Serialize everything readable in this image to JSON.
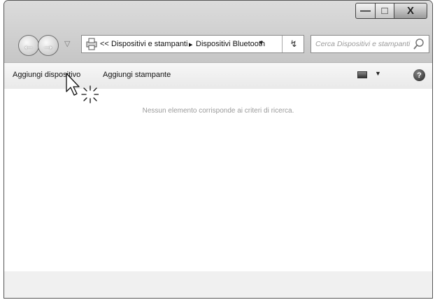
{
  "window": {
    "controls": {
      "minimize_icon": "minimize-icon",
      "maximize_icon": "maximize-icon",
      "close_label": "X"
    }
  },
  "navigation": {
    "back_icon": "back-arrow-icon",
    "forward_icon": "forward-arrow-icon",
    "recent_icon": "chevron-down-icon"
  },
  "address_bar": {
    "icon": "printer-folder-icon",
    "overflow": "<<",
    "breadcrumbs": [
      "Dispositivi e stampanti",
      "Dispositivi Bluetooth"
    ],
    "separator": "▸",
    "dropdown": "▼",
    "refresh_icon": "refresh-icon"
  },
  "search": {
    "placeholder": "Cerca Dispositivi e stampanti",
    "icon": "search-icon"
  },
  "toolbar": {
    "add_device": "Aggiungi dispositivo",
    "add_printer": "Aggiungi stampante",
    "view_dropdown": "▼",
    "help_label": "?"
  },
  "content": {
    "empty_message": "Nessun elemento corrisponde ai criteri di ricerca."
  }
}
